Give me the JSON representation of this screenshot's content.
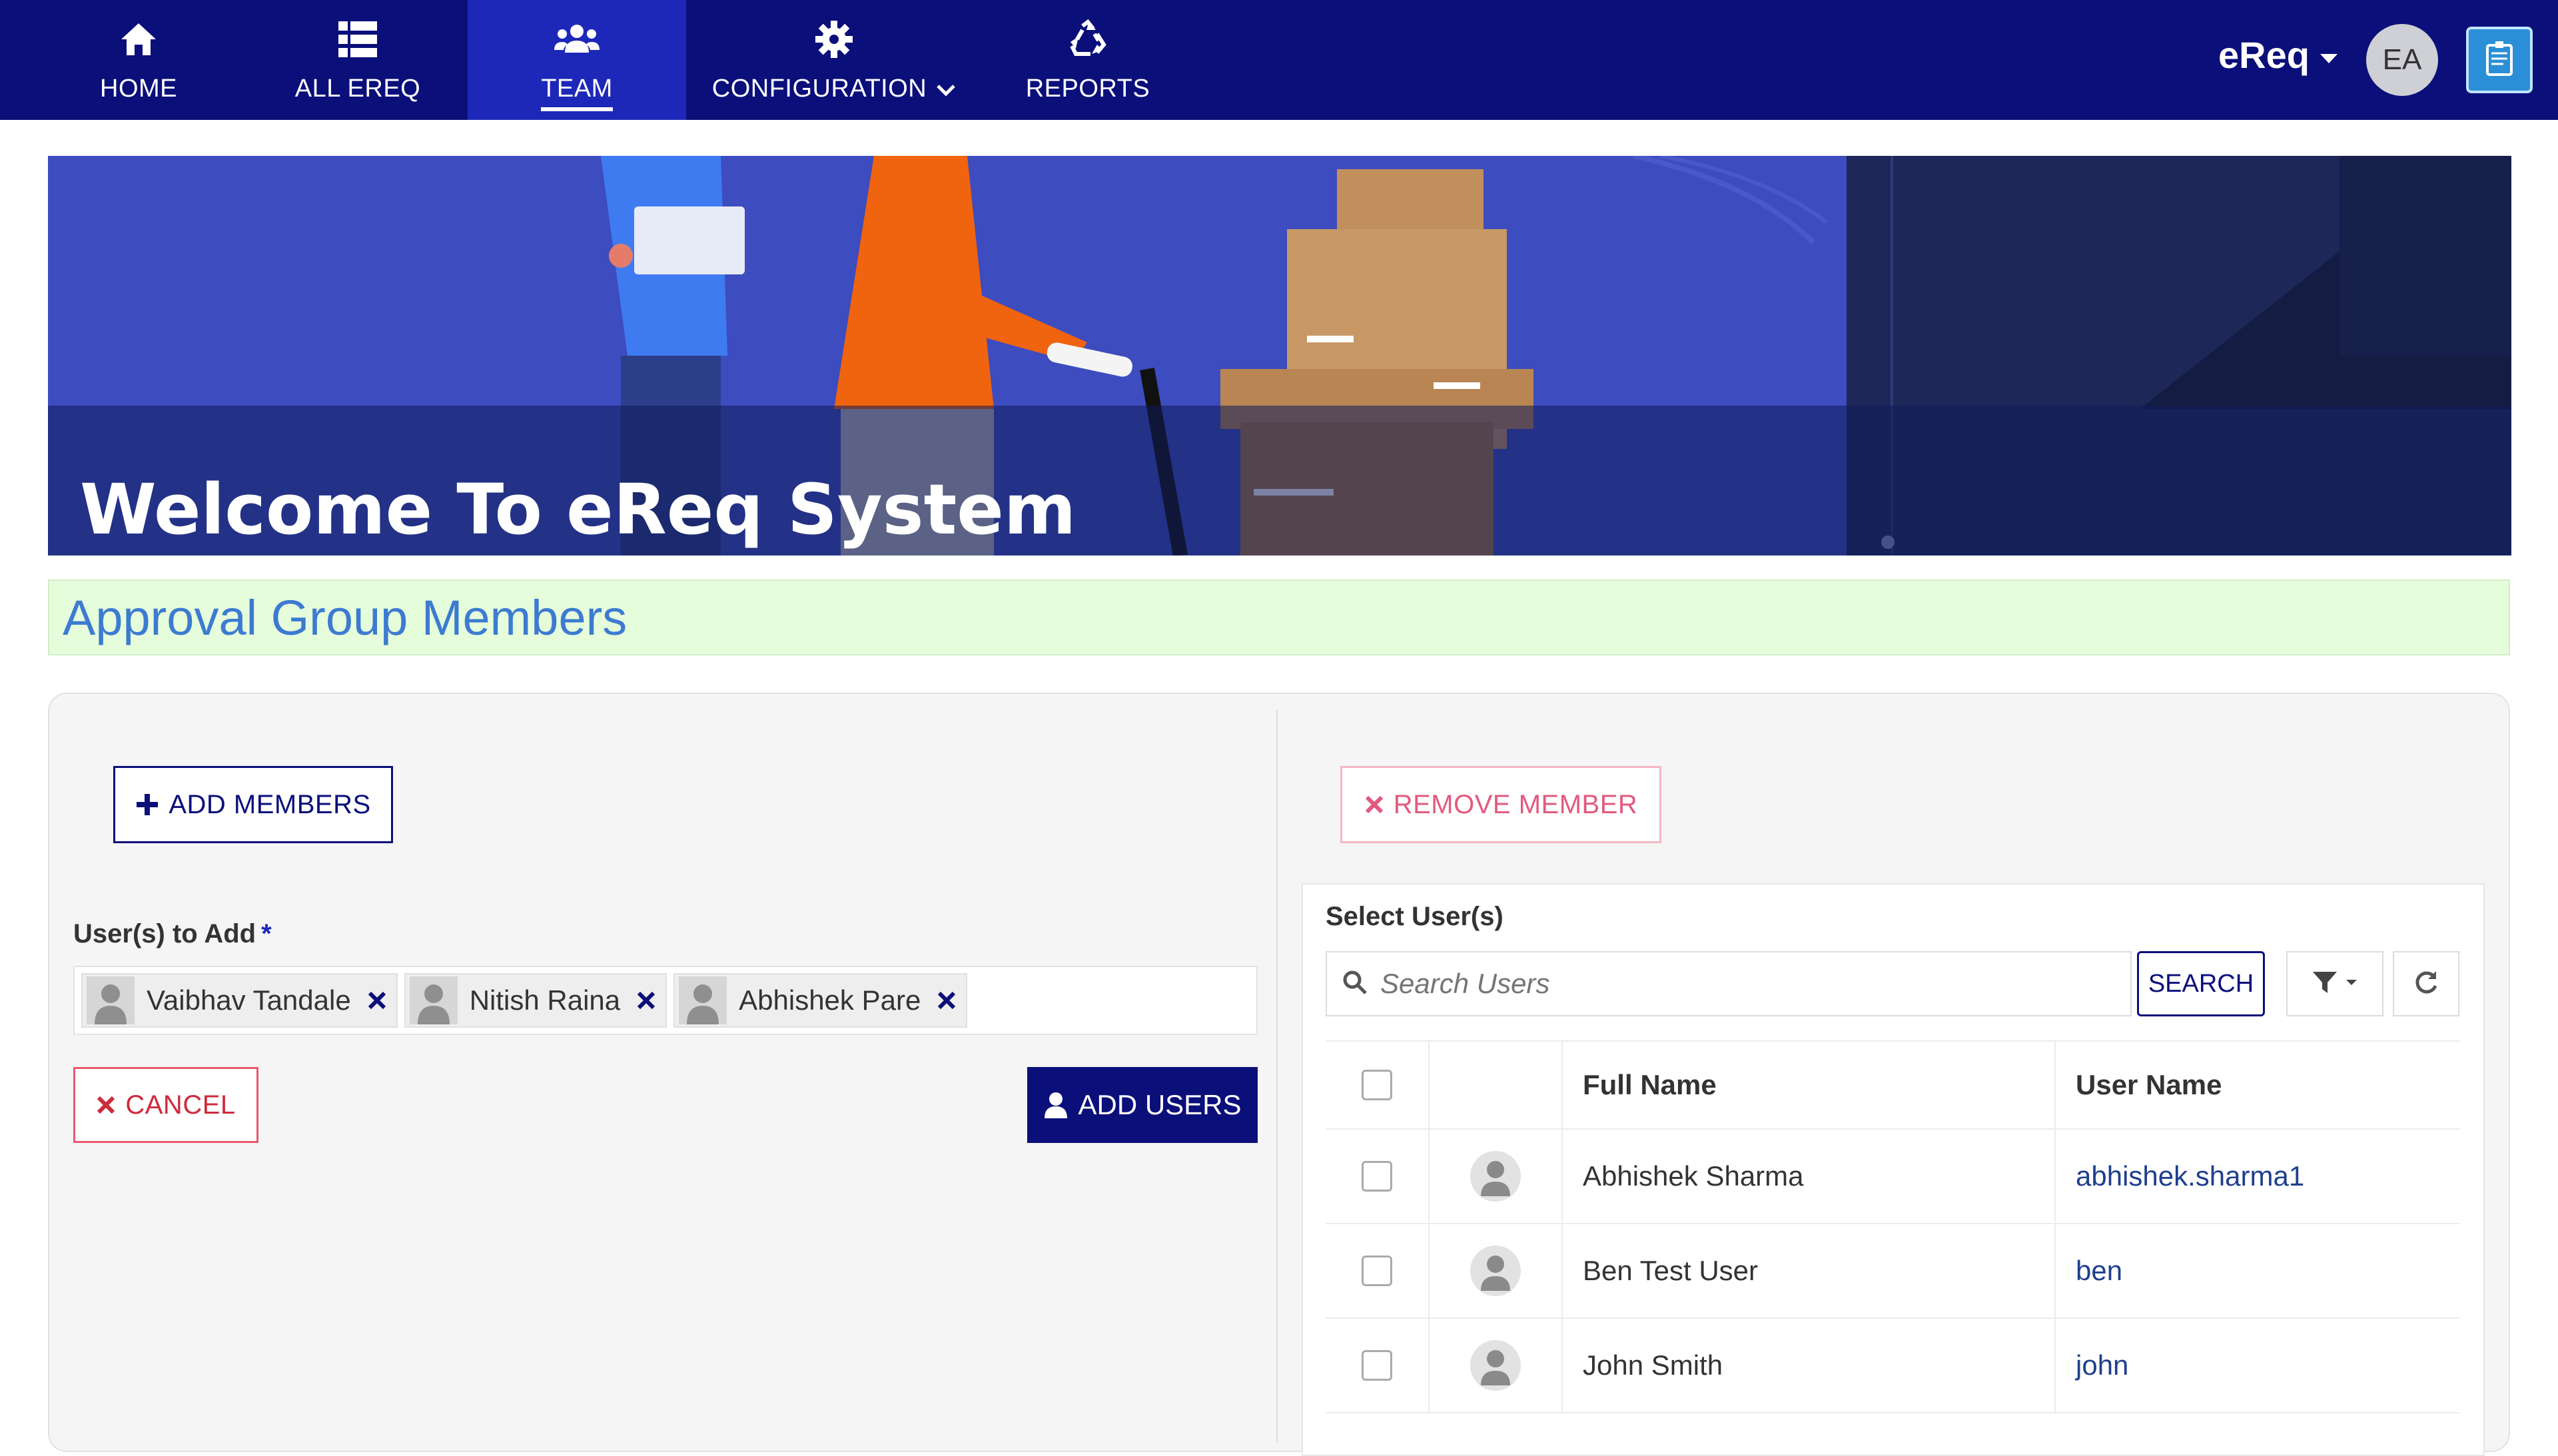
{
  "nav": {
    "items": [
      {
        "label": "HOME",
        "icon": "home-icon"
      },
      {
        "label": "ALL EREQ",
        "icon": "list-icon"
      },
      {
        "label": "TEAM",
        "icon": "users-icon",
        "active": true
      },
      {
        "label": "CONFIGURATION",
        "icon": "gear-icon",
        "has_dropdown": true
      },
      {
        "label": "REPORTS",
        "icon": "recycle-icon"
      }
    ],
    "app_menu": "eReq",
    "user_initials": "EA"
  },
  "banner": {
    "title": "Welcome To eReq System"
  },
  "page": {
    "section_title": "Approval Group Members"
  },
  "left": {
    "add_members_label": "ADD MEMBERS",
    "users_to_add_label": "User(s) to Add",
    "required_mark": "*",
    "selected_users": [
      "Vaibhav Tandale",
      "Nitish Raina",
      "Abhishek Pare"
    ],
    "cancel_label": "CANCEL",
    "add_users_label": "ADD USERS"
  },
  "right": {
    "remove_member_label": "REMOVE MEMBER",
    "select_users_label": "Select User(s)",
    "search_placeholder": "Search Users",
    "search_button": "SEARCH",
    "table": {
      "headers": [
        "Full Name",
        "User Name"
      ],
      "rows": [
        {
          "full_name": "Abhishek Sharma",
          "user_name": "abhishek.sharma1"
        },
        {
          "full_name": "Ben Test User",
          "user_name": "ben"
        },
        {
          "full_name": "John Smith",
          "user_name": "john"
        }
      ]
    }
  },
  "colors": {
    "nav_bg": "#0b0f7a",
    "nav_active": "#1e28b8",
    "section_bg": "#e6fddc",
    "section_text": "#3d7bd1",
    "danger": "#cc2b3d"
  }
}
